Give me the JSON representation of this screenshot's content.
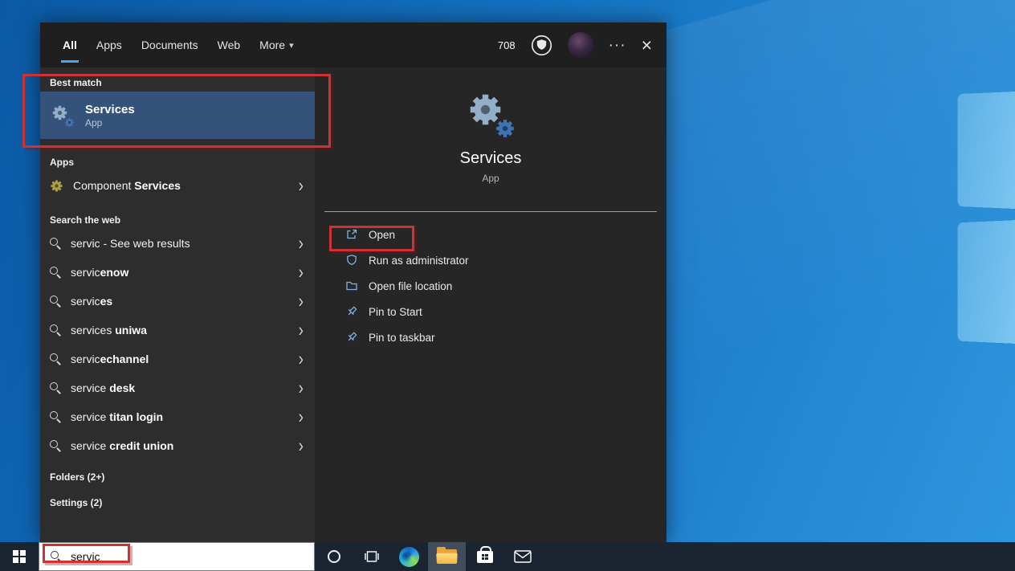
{
  "colors": {
    "accent": "#4ca6e8",
    "annotation": "#cf3232",
    "best_match_highlight": "#35537a",
    "taskbar": "#1b2531"
  },
  "icons": {
    "more": "···",
    "close": "×",
    "chevron": "›",
    "dropdown": "▾"
  },
  "tabs": [
    {
      "label": "All",
      "active": true
    },
    {
      "label": "Apps",
      "active": false
    },
    {
      "label": "Documents",
      "active": false
    },
    {
      "label": "Web",
      "active": false
    },
    {
      "label": "More",
      "active": false
    }
  ],
  "header": {
    "defender_count": "708"
  },
  "left": {
    "best_match_header": "Best match",
    "best_match": {
      "title": "Services",
      "subtitle": "App"
    },
    "apps_header": "Apps",
    "app_item": {
      "pre": "Component ",
      "bold": "Services",
      "suffix": ""
    },
    "web_header": "Search the web",
    "web": [
      {
        "pre": "servic",
        "bold": "",
        "suffix": " - See web results"
      },
      {
        "pre": "servic",
        "bold": "enow",
        "suffix": ""
      },
      {
        "pre": "servic",
        "bold": "es",
        "suffix": ""
      },
      {
        "pre": "services ",
        "bold": "uniwa",
        "suffix": ""
      },
      {
        "pre": "servic",
        "bold": "echannel",
        "suffix": ""
      },
      {
        "pre": "service ",
        "bold": "desk",
        "suffix": ""
      },
      {
        "pre": "service ",
        "bold": "titan login",
        "suffix": ""
      },
      {
        "pre": "service ",
        "bold": "credit union",
        "suffix": ""
      }
    ],
    "folders_header": "Folders (2+)",
    "settings_header": "Settings (2)"
  },
  "preview": {
    "title": "Services",
    "subtitle": "App",
    "actions": [
      {
        "label": "Open"
      },
      {
        "label": "Run as administrator"
      },
      {
        "label": "Open file location"
      },
      {
        "label": "Pin to Start"
      },
      {
        "label": "Pin to taskbar"
      }
    ]
  },
  "taskbar": {
    "search_value": "servic"
  }
}
